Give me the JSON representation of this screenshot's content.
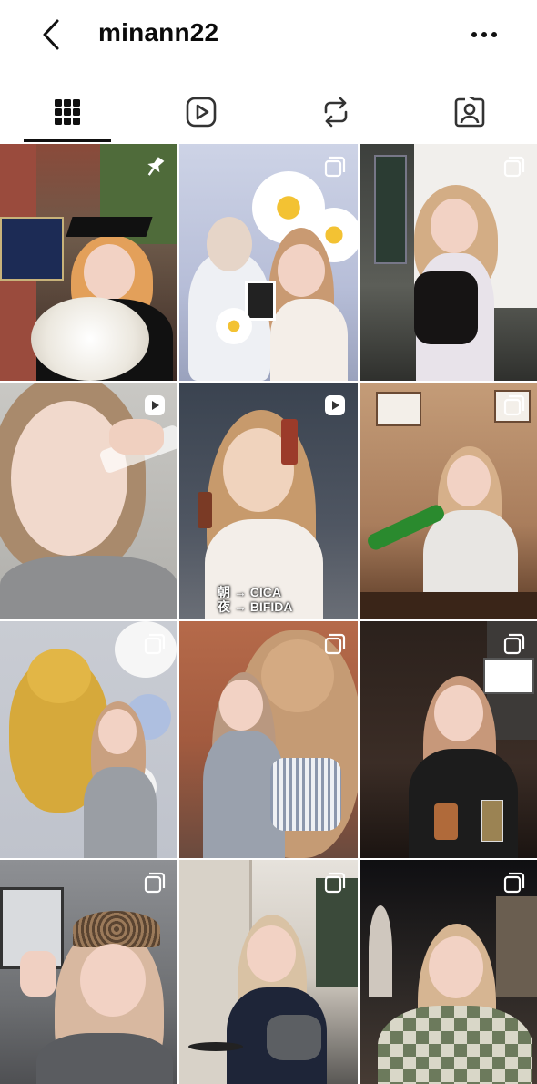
{
  "header": {
    "username": "minann22",
    "back_icon": "chevron-left-icon",
    "more_icon": "more-horizontal-icon"
  },
  "tabs": [
    {
      "name": "posts",
      "icon": "grid-icon",
      "active": true
    },
    {
      "name": "reels",
      "icon": "reels-play-icon",
      "active": false
    },
    {
      "name": "reposts",
      "icon": "repost-icon",
      "active": false
    },
    {
      "name": "tagged",
      "icon": "tagged-person-icon",
      "active": false
    }
  ],
  "posts": [
    {
      "kind": "pinned",
      "icon": "pin-icon",
      "scene": "graduation"
    },
    {
      "kind": "carousel",
      "icon": "carousel-icon",
      "scene": "toy-daisies"
    },
    {
      "kind": "carousel",
      "icon": "carousel-icon",
      "scene": "exhibition"
    },
    {
      "kind": "reel",
      "icon": "reel-icon",
      "scene": "skincare-closeup"
    },
    {
      "kind": "reel",
      "icon": "reel-icon",
      "scene": "skincare-serum",
      "overlay_text": "朝 → CICA\n夜 → BIFIDA"
    },
    {
      "kind": "carousel",
      "icon": "carousel-icon",
      "scene": "restaurant-bottle"
    },
    {
      "kind": "carousel",
      "icon": "carousel-icon",
      "scene": "teddy-balloons"
    },
    {
      "kind": "carousel",
      "icon": "carousel-icon",
      "scene": "giant-bear"
    },
    {
      "kind": "carousel",
      "icon": "carousel-icon",
      "scene": "bar-night"
    },
    {
      "kind": "carousel",
      "icon": "carousel-icon",
      "scene": "car-selfie"
    },
    {
      "kind": "carousel",
      "icon": "carousel-icon",
      "scene": "street-cafe"
    },
    {
      "kind": "carousel",
      "icon": "carousel-icon",
      "scene": "night-terrace"
    }
  ],
  "colors": {
    "text": "#111111",
    "background": "#ffffff",
    "overlay_icon": "#ffffff"
  }
}
